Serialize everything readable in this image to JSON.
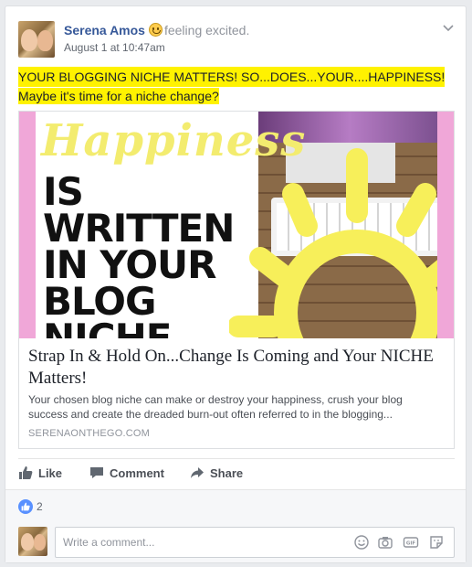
{
  "post": {
    "author": "Serena Amos",
    "feeling": "feeling excited.",
    "timestamp": "August 1 at 10:47am",
    "text_line1": "YOUR BLOGGING NICHE MATTERS! SO...DOES...YOUR....HAPPINESS!",
    "text_line2": "Maybe it's time for a niche change?"
  },
  "link_preview": {
    "image_text_script": "Happiness",
    "image_text_block": "IS\nWRITTEN\nIN YOUR\nBLOG\nNICHE",
    "title": "Strap In & Hold On...Change Is Coming and Your NICHE Matters!",
    "description": "Your chosen blog niche can make or destroy your happiness, crush your blog success and create the dreaded burn-out often referred to in the blogging...",
    "domain": "SERENAONTHEGO.COM"
  },
  "actions": {
    "like": "Like",
    "comment": "Comment",
    "share": "Share"
  },
  "reactions": {
    "like_count": "2"
  },
  "comment_box": {
    "placeholder": "Write a comment..."
  },
  "colors": {
    "name_link": "#365899",
    "highlight": "#fff200",
    "like_blue": "#5890ff",
    "sun_yellow": "#f7ef5a"
  },
  "icons": [
    "chevron-down-icon",
    "feeling-emoji-icon",
    "like-icon",
    "comment-icon",
    "share-icon",
    "emoji-icon",
    "camera-icon",
    "gif-icon",
    "sticker-icon"
  ]
}
